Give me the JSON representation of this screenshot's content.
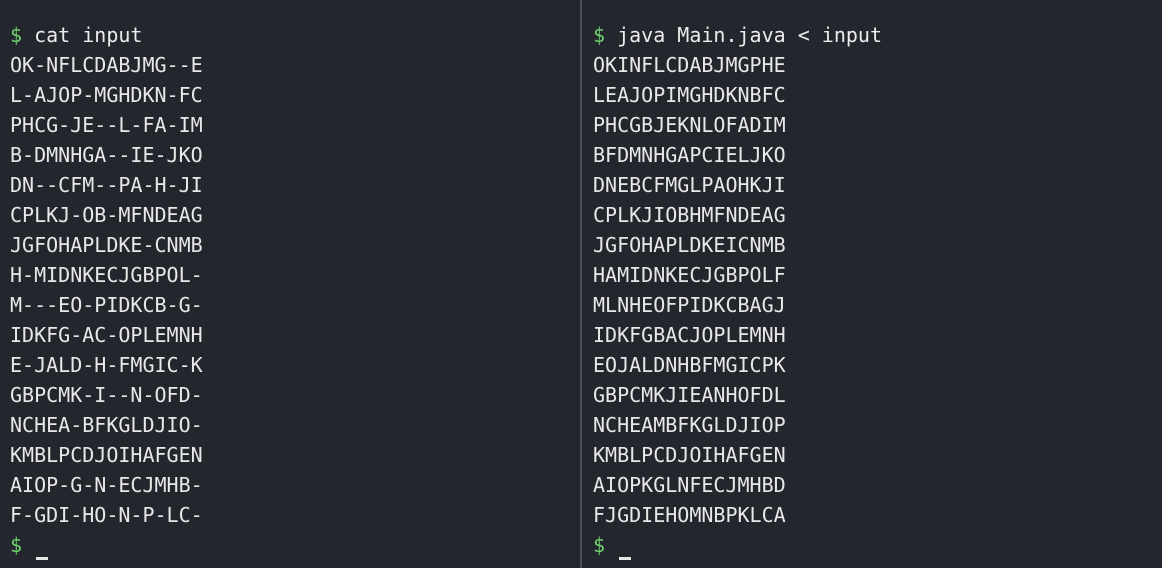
{
  "prompt_symbol": "$",
  "left_pane": {
    "command": "cat input",
    "lines": [
      "OK-NFLCDABJMG--E",
      "L-AJOP-MGHDKN-FC",
      "PHCG-JE--L-FA-IM",
      "B-DMNHGA--IE-JKO",
      "DN--CFM--PA-H-JI",
      "CPLKJ-OB-MFNDEAG",
      "JGFOHAPLDKE-CNMB",
      "H-MIDNKECJGBPOL-",
      "M---EO-PIDKCB-G-",
      "IDKFG-AC-OPLEMNH",
      "E-JALD-H-FMGIC-K",
      "GBPCMK-I--N-OFD-",
      "NCHEA-BFKGLDJIO-",
      "KMBLPCDJOIHAFGEN",
      "AIOP-G-N-ECJMHB-",
      "F-GDI-HO-N-P-LC-"
    ]
  },
  "right_pane": {
    "command": "java Main.java < input",
    "lines": [
      "OKINFLCDABJMGPHE",
      "LEAJOPIMGHDKNBFC",
      "PHCGBJEKNLOFADIM",
      "BFDMNHGAPCIELJKO",
      "DNEBCFMGLPAOHKJI",
      "CPLKJIOBHMFNDEAG",
      "JGFOHAPLDKEICNMB",
      "HAMIDNKECJGBPOLF",
      "MLNHEOFPIDKCBAGJ",
      "IDKFGBACJOPLEMNH",
      "EOJALDNHBFMGICPK",
      "GBPCMKJIEANHOFDL",
      "NCHEAMBFKGLDJIOP",
      "KMBLPCDJOIHAFGEN",
      "AIOPKGLNFECJMHBD",
      "FJGDIEHOMNBPKLCA"
    ]
  },
  "colors": {
    "background": "#23262d",
    "prompt": "#6fd26f",
    "text": "#e8e8e8",
    "divider": "#4a4e56"
  }
}
